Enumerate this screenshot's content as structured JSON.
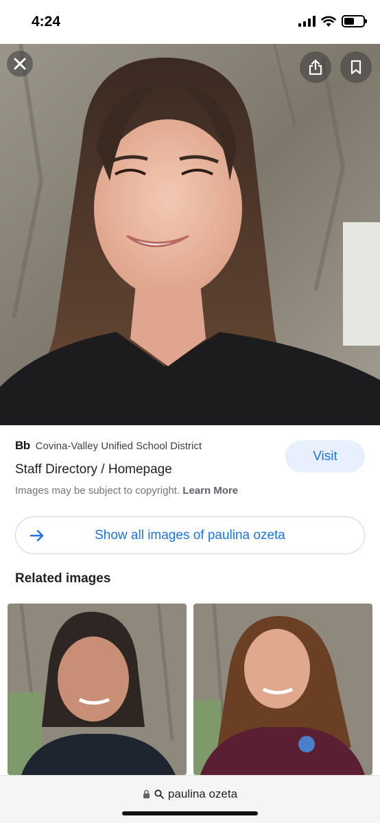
{
  "status_bar": {
    "time": "4:24"
  },
  "hero": {
    "icons": [
      "close-icon",
      "share-icon",
      "bookmark-icon"
    ]
  },
  "source": {
    "logo": "Bb",
    "site_name": "Covina-Valley Unified School District",
    "page_title": "Staff Directory / Homepage",
    "copyright_text": "Images may be subject to copyright.",
    "learn_more": "Learn More",
    "visit_label": "Visit"
  },
  "show_all": {
    "label": "Show all images of paulina ozeta",
    "icon": "arrow-right-icon"
  },
  "related": {
    "title": "Related images"
  },
  "bottom_bar": {
    "query": "paulina ozeta",
    "icons": [
      "lock-icon",
      "search-icon"
    ]
  },
  "colors": {
    "accent": "#1a73e8",
    "visit_bg": "#e8f0fe",
    "muted_text": "#70757a"
  }
}
